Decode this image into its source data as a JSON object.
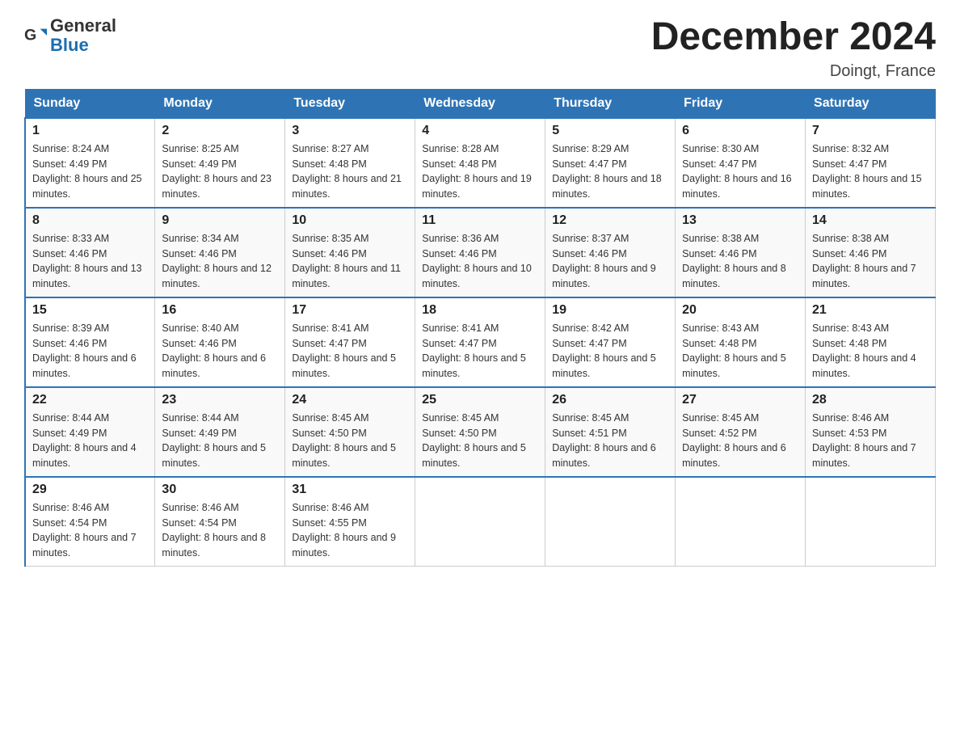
{
  "header": {
    "logo_general": "General",
    "logo_blue": "Blue",
    "month_title": "December 2024",
    "location": "Doingt, France"
  },
  "days_of_week": [
    "Sunday",
    "Monday",
    "Tuesday",
    "Wednesday",
    "Thursday",
    "Friday",
    "Saturday"
  ],
  "weeks": [
    [
      {
        "day": "1",
        "sunrise": "8:24 AM",
        "sunset": "4:49 PM",
        "daylight": "8 hours and 25 minutes."
      },
      {
        "day": "2",
        "sunrise": "8:25 AM",
        "sunset": "4:49 PM",
        "daylight": "8 hours and 23 minutes."
      },
      {
        "day": "3",
        "sunrise": "8:27 AM",
        "sunset": "4:48 PM",
        "daylight": "8 hours and 21 minutes."
      },
      {
        "day": "4",
        "sunrise": "8:28 AM",
        "sunset": "4:48 PM",
        "daylight": "8 hours and 19 minutes."
      },
      {
        "day": "5",
        "sunrise": "8:29 AM",
        "sunset": "4:47 PM",
        "daylight": "8 hours and 18 minutes."
      },
      {
        "day": "6",
        "sunrise": "8:30 AM",
        "sunset": "4:47 PM",
        "daylight": "8 hours and 16 minutes."
      },
      {
        "day": "7",
        "sunrise": "8:32 AM",
        "sunset": "4:47 PM",
        "daylight": "8 hours and 15 minutes."
      }
    ],
    [
      {
        "day": "8",
        "sunrise": "8:33 AM",
        "sunset": "4:46 PM",
        "daylight": "8 hours and 13 minutes."
      },
      {
        "day": "9",
        "sunrise": "8:34 AM",
        "sunset": "4:46 PM",
        "daylight": "8 hours and 12 minutes."
      },
      {
        "day": "10",
        "sunrise": "8:35 AM",
        "sunset": "4:46 PM",
        "daylight": "8 hours and 11 minutes."
      },
      {
        "day": "11",
        "sunrise": "8:36 AM",
        "sunset": "4:46 PM",
        "daylight": "8 hours and 10 minutes."
      },
      {
        "day": "12",
        "sunrise": "8:37 AM",
        "sunset": "4:46 PM",
        "daylight": "8 hours and 9 minutes."
      },
      {
        "day": "13",
        "sunrise": "8:38 AM",
        "sunset": "4:46 PM",
        "daylight": "8 hours and 8 minutes."
      },
      {
        "day": "14",
        "sunrise": "8:38 AM",
        "sunset": "4:46 PM",
        "daylight": "8 hours and 7 minutes."
      }
    ],
    [
      {
        "day": "15",
        "sunrise": "8:39 AM",
        "sunset": "4:46 PM",
        "daylight": "8 hours and 6 minutes."
      },
      {
        "day": "16",
        "sunrise": "8:40 AM",
        "sunset": "4:46 PM",
        "daylight": "8 hours and 6 minutes."
      },
      {
        "day": "17",
        "sunrise": "8:41 AM",
        "sunset": "4:47 PM",
        "daylight": "8 hours and 5 minutes."
      },
      {
        "day": "18",
        "sunrise": "8:41 AM",
        "sunset": "4:47 PM",
        "daylight": "8 hours and 5 minutes."
      },
      {
        "day": "19",
        "sunrise": "8:42 AM",
        "sunset": "4:47 PM",
        "daylight": "8 hours and 5 minutes."
      },
      {
        "day": "20",
        "sunrise": "8:43 AM",
        "sunset": "4:48 PM",
        "daylight": "8 hours and 5 minutes."
      },
      {
        "day": "21",
        "sunrise": "8:43 AM",
        "sunset": "4:48 PM",
        "daylight": "8 hours and 4 minutes."
      }
    ],
    [
      {
        "day": "22",
        "sunrise": "8:44 AM",
        "sunset": "4:49 PM",
        "daylight": "8 hours and 4 minutes."
      },
      {
        "day": "23",
        "sunrise": "8:44 AM",
        "sunset": "4:49 PM",
        "daylight": "8 hours and 5 minutes."
      },
      {
        "day": "24",
        "sunrise": "8:45 AM",
        "sunset": "4:50 PM",
        "daylight": "8 hours and 5 minutes."
      },
      {
        "day": "25",
        "sunrise": "8:45 AM",
        "sunset": "4:50 PM",
        "daylight": "8 hours and 5 minutes."
      },
      {
        "day": "26",
        "sunrise": "8:45 AM",
        "sunset": "4:51 PM",
        "daylight": "8 hours and 6 minutes."
      },
      {
        "day": "27",
        "sunrise": "8:45 AM",
        "sunset": "4:52 PM",
        "daylight": "8 hours and 6 minutes."
      },
      {
        "day": "28",
        "sunrise": "8:46 AM",
        "sunset": "4:53 PM",
        "daylight": "8 hours and 7 minutes."
      }
    ],
    [
      {
        "day": "29",
        "sunrise": "8:46 AM",
        "sunset": "4:54 PM",
        "daylight": "8 hours and 7 minutes."
      },
      {
        "day": "30",
        "sunrise": "8:46 AM",
        "sunset": "4:54 PM",
        "daylight": "8 hours and 8 minutes."
      },
      {
        "day": "31",
        "sunrise": "8:46 AM",
        "sunset": "4:55 PM",
        "daylight": "8 hours and 9 minutes."
      },
      null,
      null,
      null,
      null
    ]
  ]
}
